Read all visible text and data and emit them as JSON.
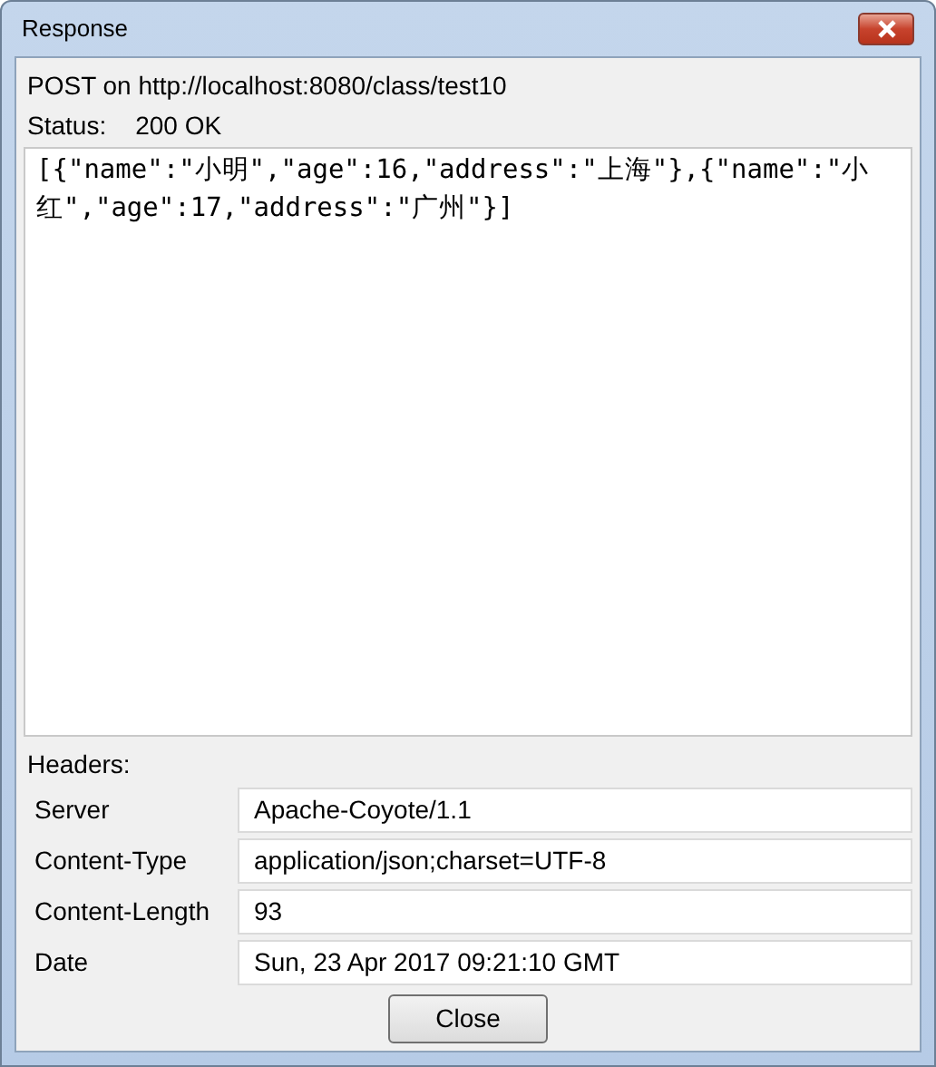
{
  "window": {
    "title": "Response"
  },
  "request_line": "POST on http://localhost:8080/class/test10",
  "status": {
    "label": "Status:",
    "value": "200 OK"
  },
  "body": "[{\"name\":\"小明\",\"age\":16,\"address\":\"上海\"},{\"name\":\"小红\",\"age\":17,\"address\":\"广州\"}]",
  "headers_label": "Headers:",
  "headers": [
    {
      "name": "Server",
      "value": "Apache-Coyote/1.1"
    },
    {
      "name": "Content-Type",
      "value": "application/json;charset=UTF-8"
    },
    {
      "name": "Content-Length",
      "value": "93"
    },
    {
      "name": "Date",
      "value": "Sun, 23 Apr 2017 09:21:10 GMT"
    }
  ],
  "buttons": [
    "Close"
  ]
}
